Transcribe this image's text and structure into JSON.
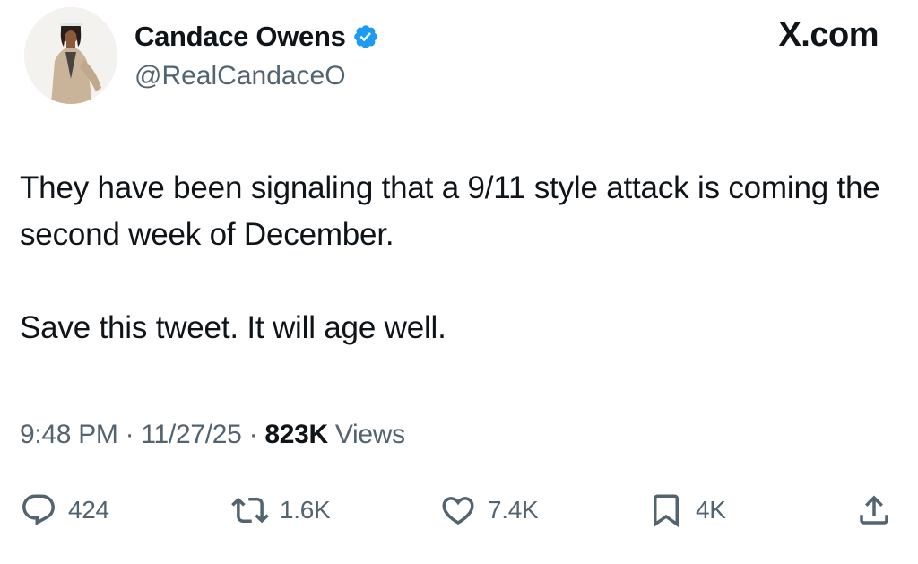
{
  "brand": "X.com",
  "author": {
    "display_name": "Candace Owens",
    "handle": "@RealCandaceO",
    "verified": true,
    "avatar_icon": "profile-photo"
  },
  "tweet": {
    "paragraphs": [
      "They have been signaling that a 9/11 style attack is coming the second week of December.",
      "Save this tweet. It will age well."
    ],
    "time": "9:48 PM",
    "separator_1": " · ",
    "date": "11/27/25",
    "separator_2": " · ",
    "views_count": "823K",
    "views_label": " Views"
  },
  "actions": {
    "reply": {
      "icon": "reply-icon",
      "count": "424"
    },
    "repost": {
      "icon": "repost-icon",
      "count": "1.6K"
    },
    "like": {
      "icon": "heart-icon",
      "count": "7.4K"
    },
    "bookmark": {
      "icon": "bookmark-icon",
      "count": "4K"
    },
    "share": {
      "icon": "share-icon"
    }
  },
  "colors": {
    "text_primary": "#0f1419",
    "text_secondary": "#536471",
    "verified_badge": "#1d9bf0"
  }
}
